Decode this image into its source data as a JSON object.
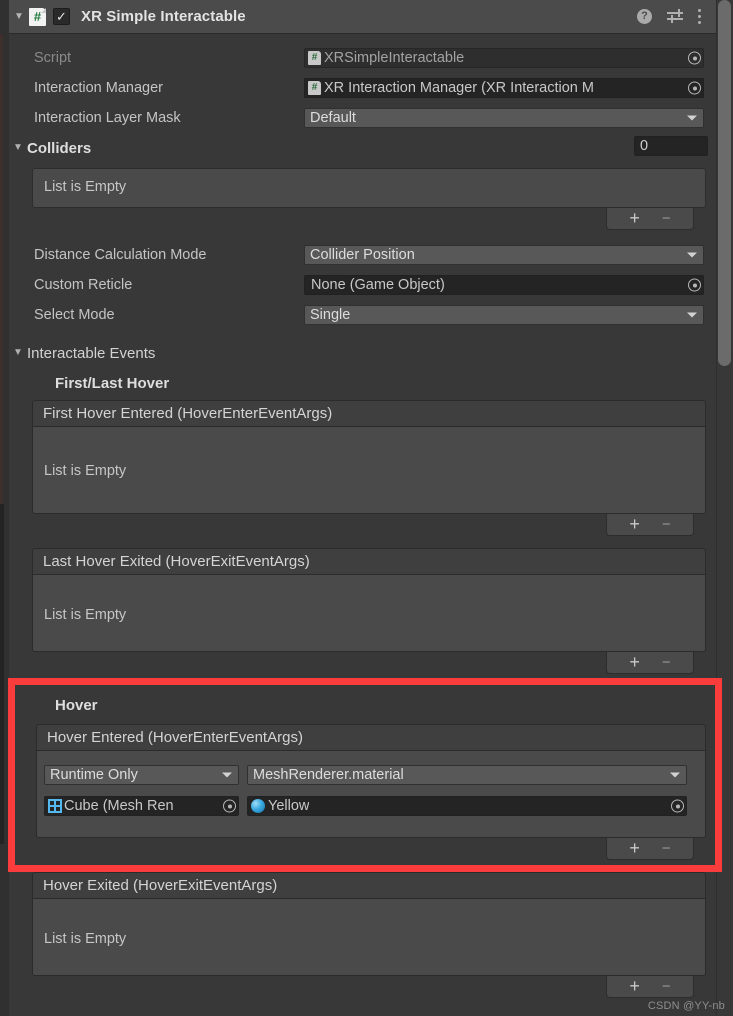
{
  "component": {
    "title": "XR Simple Interactable",
    "enabled_check": "✓",
    "foldout_arrow": "▼",
    "script_icon_glyph": "#",
    "header_icons": [
      {
        "name": "help-icon",
        "glyph": "?"
      },
      {
        "name": "preset-icon",
        "glyph": ""
      },
      {
        "name": "kebab-menu-icon",
        "glyph": ""
      }
    ]
  },
  "fields": {
    "script": {
      "label": "Script",
      "value": "XRSimpleInteractable"
    },
    "interaction_manager": {
      "label": "Interaction Manager",
      "value": "XR Interaction Manager (XR Interaction M"
    },
    "interaction_layer_mask": {
      "label": "Interaction Layer Mask",
      "value": "Default"
    },
    "distance_calculation_mode": {
      "label": "Distance Calculation Mode",
      "value": "Collider Position"
    },
    "custom_reticle": {
      "label": "Custom Reticle",
      "value": "None (Game Object)"
    },
    "select_mode": {
      "label": "Select Mode",
      "value": "Single"
    }
  },
  "colliders": {
    "label": "Colliders",
    "count": "0",
    "empty_text": "List is Empty",
    "add_label": "+",
    "remove_label": "−"
  },
  "interactable_events": {
    "label": "Interactable Events",
    "groups": [
      {
        "name": "first-last-hover",
        "label": "First/Last Hover",
        "events": [
          {
            "name": "first-hover-entered",
            "title": "First Hover Entered (HoverEnterEventArgs)",
            "empty_text": "List is Empty"
          },
          {
            "name": "last-hover-exited",
            "title": "Last Hover Exited (HoverExitEventArgs)",
            "empty_text": "List is Empty"
          }
        ]
      },
      {
        "name": "hover",
        "label": "Hover",
        "events": [
          {
            "name": "hover-entered",
            "title": "Hover Entered (HoverEnterEventArgs)",
            "listener": {
              "call_state": "Runtime Only",
              "method": "MeshRenderer.material",
              "target_object": "Cube (Mesh Ren",
              "argument_object": "Yellow"
            }
          },
          {
            "name": "hover-exited",
            "title": "Hover Exited (HoverExitEventArgs)",
            "empty_text": "List is Empty"
          }
        ]
      }
    ],
    "add_label": "+",
    "remove_label": "−"
  },
  "annotation": {
    "name": "red-highlight-box",
    "color": "#fa3c3c"
  },
  "watermark": {
    "text": "CSDN @YY-nb"
  },
  "colors": {
    "background": "#383838",
    "header_bar": "#4b4b4b",
    "object_field": "#242424",
    "dropdown": "#585858",
    "list_box": "#4a4a4a",
    "accent_red": "#fa3c3c",
    "script_icon_green": "#1f7a3a",
    "mesh_icon_blue": "#53b9ef"
  }
}
